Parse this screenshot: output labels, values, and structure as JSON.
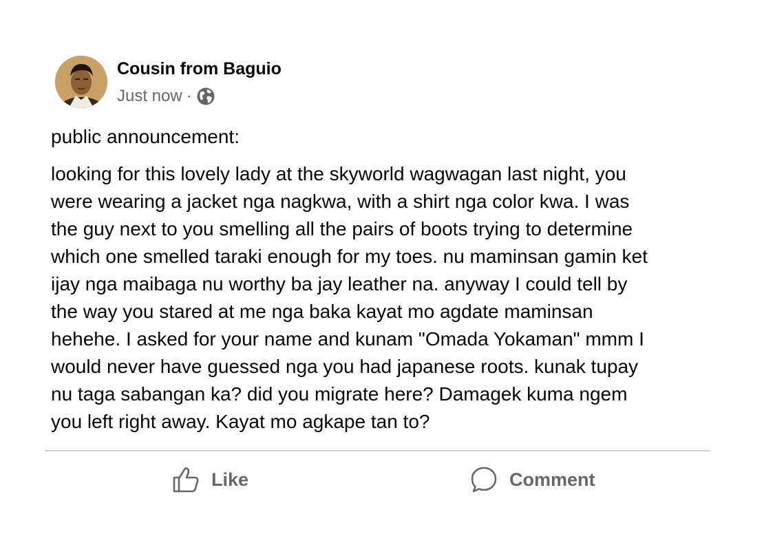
{
  "post": {
    "author": "Cousin from Baguio",
    "timestamp": "Just now",
    "separator": "·",
    "privacy_icon": "globe-icon",
    "heading": "public announcement:",
    "body_lines": [
      "looking for this lovely lady at the skyworld wagwagan last night, you",
      "were wearing a jacket nga nagkwa, with a shirt nga color kwa. I was",
      "the guy next to you smelling all the pairs of boots trying to determine",
      "which one smelled taraki enough for my toes. nu maminsan gamin ket",
      "ijay nga maibaga nu worthy ba jay leather na. anyway I could tell by",
      "the way you stared at me nga baka kayat mo agdate maminsan",
      "hehehe. I asked for your name and kunam \"Omada Yokaman\" mmm I",
      "would never have guessed nga you had japanese roots. kunak tupay",
      "nu taga sabangan ka? did you migrate here? Damagek kuma ngem",
      "you left right away. Kayat mo agkape tan to?"
    ]
  },
  "actions": {
    "like_label": "Like",
    "like_icon": "thumbs-up-icon",
    "comment_label": "Comment",
    "comment_icon": "speech-bubble-icon"
  },
  "colors": {
    "text": "#050505",
    "secondary": "#65676b",
    "divider": "#cfd1d5",
    "background": "#ffffff"
  }
}
